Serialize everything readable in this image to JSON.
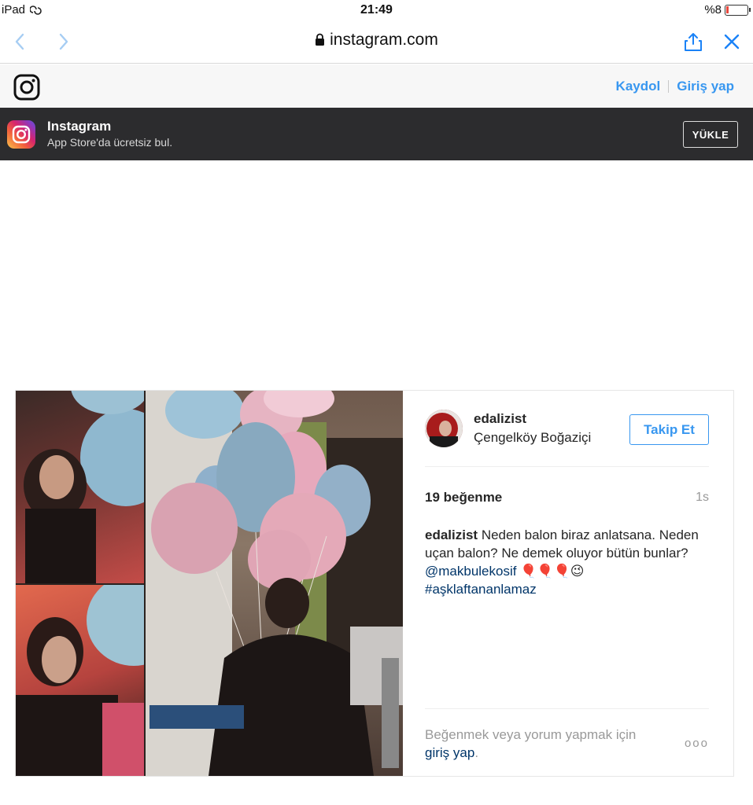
{
  "status_bar": {
    "device": "iPad",
    "time": "21:49",
    "battery": "%8"
  },
  "browser": {
    "url": "instagram.com",
    "icons": [
      "back-chevron-icon",
      "forward-chevron-icon",
      "lock-icon",
      "share-icon",
      "close-icon"
    ]
  },
  "ig_header": {
    "signup": "Kaydol",
    "login": "Giriş yap"
  },
  "app_banner": {
    "title": "Instagram",
    "subtitle": "App Store'da ücretsiz bul.",
    "install": "YÜKLE"
  },
  "post": {
    "username": "edalizist",
    "location": "Çengelköy Boğaziçi",
    "follow": "Takip Et",
    "likes": "19 beğenme",
    "age": "1s",
    "caption": {
      "user": "edalizist",
      "text": "Neden balon biraz anlatsana. Neden uçan balon? Ne demek oluyor bütün bunlar?",
      "mention": "@makbulekosif",
      "emoji": "🎈🎈🎈😉",
      "hashtag": "#aşklaftananlamaz"
    },
    "login_prompt": "Beğenmek veya yorum yapmak için",
    "login_link": "giriş yap",
    "login_suffix": ".",
    "more": "ooo"
  },
  "colors": {
    "link_blue": "#3897f0",
    "caption_link": "#003569",
    "banner_bg": "#2c2c2e"
  }
}
